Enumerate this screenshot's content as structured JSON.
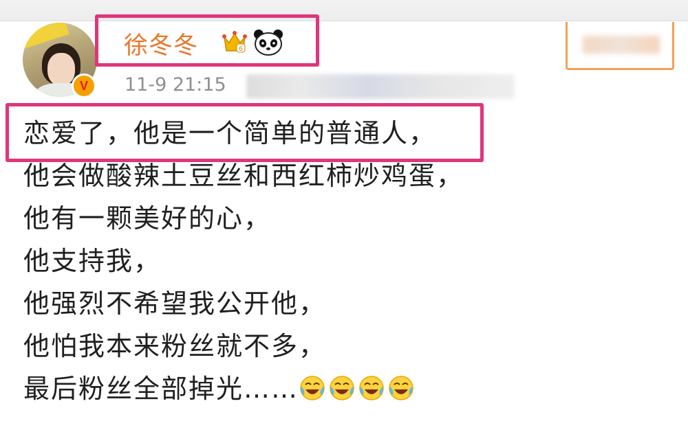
{
  "post": {
    "author": {
      "name": "徐冬冬",
      "verified_badge": "V",
      "badges": [
        "crown-icon",
        "panda-icon"
      ]
    },
    "timestamp": "11-9 21:15",
    "lines": [
      "恋爱了，他是一个简单的普通人，",
      "他会做酸辣土豆丝和西红柿炒鸡蛋，",
      "他有一颗美好的心，",
      "他支持我，",
      "他强烈不希望我公开他，",
      "他怕我本来粉丝就不多，",
      "最后粉丝全部掉光……"
    ],
    "trailing_emoji": [
      "laugh-cry-emoji",
      "laugh-cry-emoji",
      "laugh-cry-emoji",
      "laugh-cry-emoji"
    ]
  },
  "colors": {
    "username": "#e8782d",
    "highlight": "#e0357a",
    "follow_border": "#f2a154",
    "verified_badge": "#f5a000"
  }
}
